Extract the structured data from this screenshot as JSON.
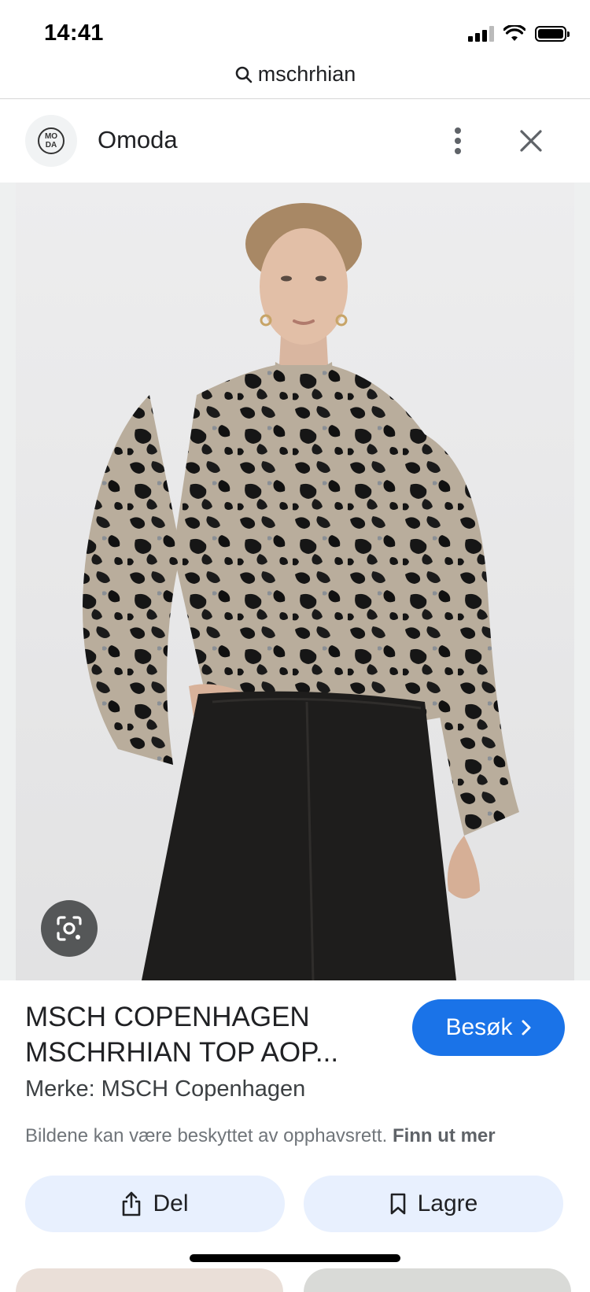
{
  "status_bar": {
    "time": "14:41"
  },
  "search": {
    "query": "mschrhian"
  },
  "source": {
    "site_name": "Omoda",
    "logo_text": "MO DA"
  },
  "image": {
    "alt": "Model wearing patterned blouse with black jeans"
  },
  "product": {
    "title_line1": "MSCH COPENHAGEN",
    "title_line2": "MSCHRHIAN TOP AOP...",
    "brand": "Merke: MSCH Copenhagen",
    "copyright_text": "Bildene kan være beskyttet av opphavsrett.",
    "copyright_link": "Finn ut mer"
  },
  "actions": {
    "visit": "Besøk",
    "share": "Del",
    "save": "Lagre"
  },
  "colors": {
    "accent": "#1a73e8",
    "action_bg": "#e8f0fe",
    "lens_bg": "#555758"
  }
}
